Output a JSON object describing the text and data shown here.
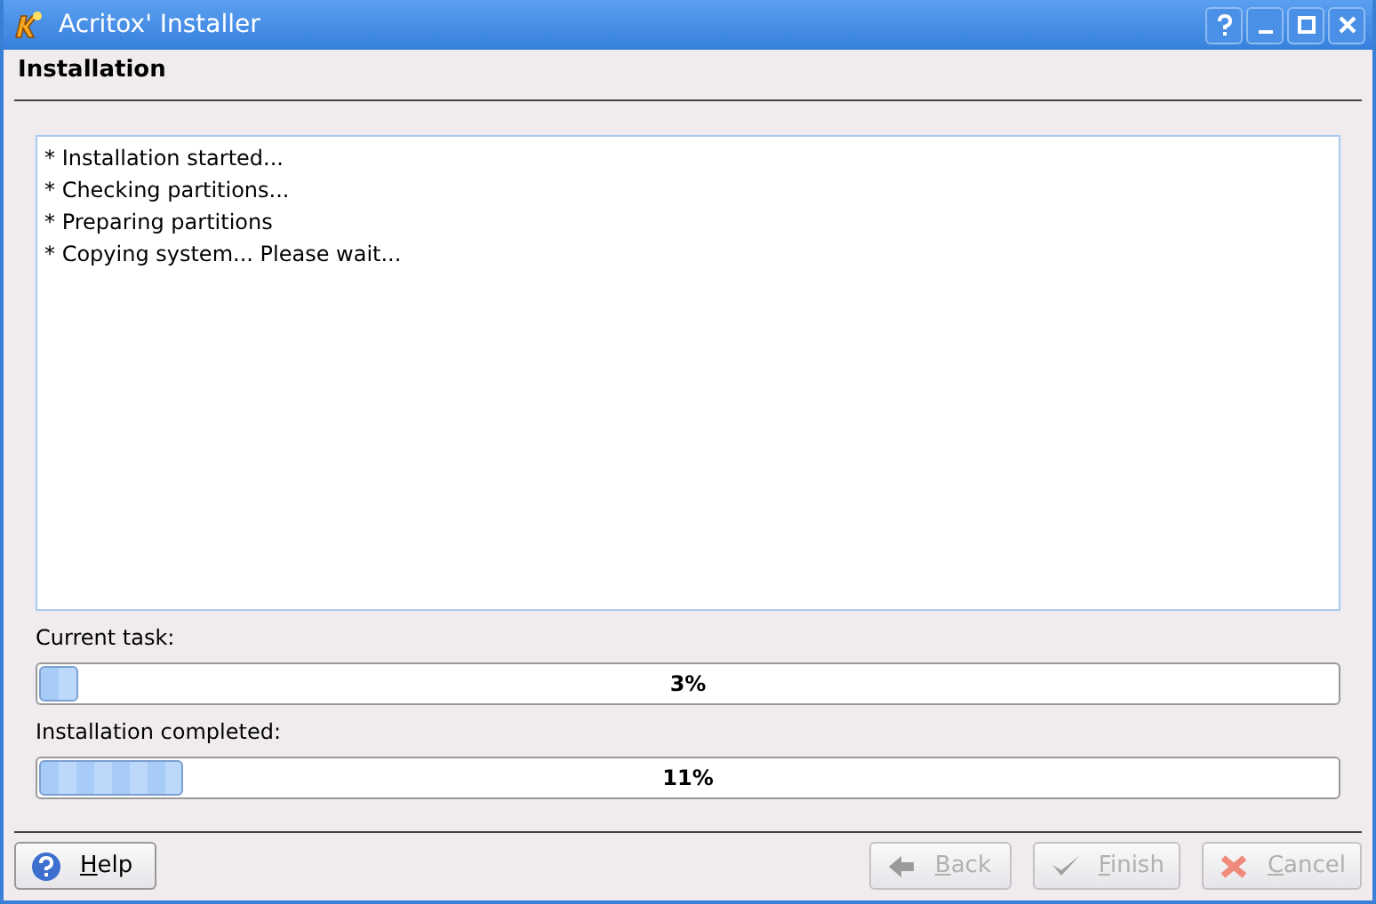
{
  "window": {
    "title": "Acritox' Installer",
    "controls": [
      {
        "kind": "help"
      },
      {
        "kind": "minimize"
      },
      {
        "kind": "maximize"
      },
      {
        "kind": "close"
      }
    ]
  },
  "page_title": "Installation",
  "log": [
    "* Installation started...",
    "* Checking partitions...",
    "* Preparing partitions",
    "* Copying system... Please wait..."
  ],
  "progress": [
    {
      "label": "Current task:",
      "level": 0.03,
      "reading": "3%"
    },
    {
      "label": "Installation completed:",
      "level": 0.11,
      "reading": "11%"
    }
  ],
  "buttons": [
    {
      "kind": "help",
      "label": "Help",
      "disabled": false
    },
    {
      "kind": "back",
      "label": "Back",
      "disabled": true
    },
    {
      "kind": "finish",
      "label": "Finish",
      "disabled": true
    },
    {
      "kind": "cancel",
      "label": "Cancel",
      "disabled": true
    }
  ]
}
